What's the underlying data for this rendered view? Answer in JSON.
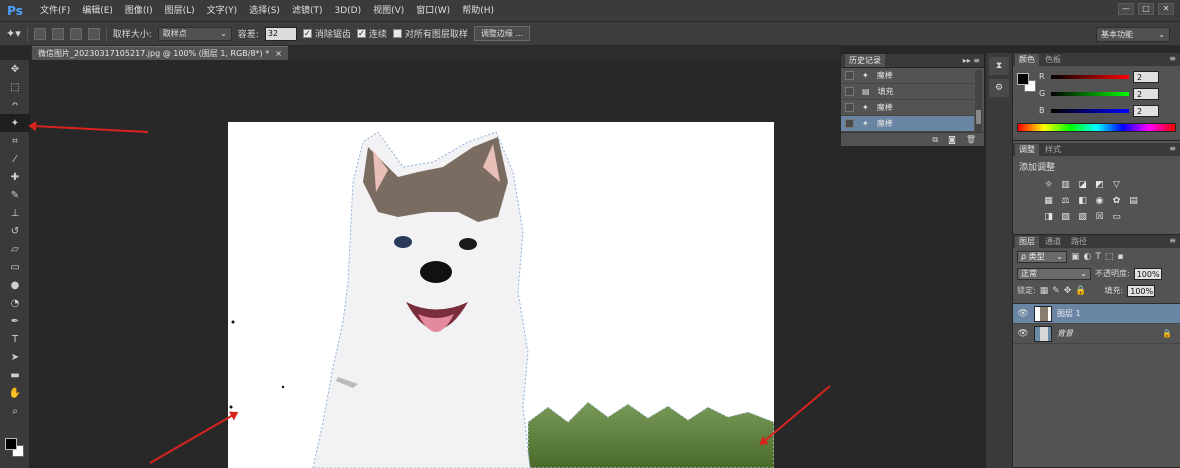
{
  "app": {
    "logo": "Ps"
  },
  "menu": [
    "文件(F)",
    "编辑(E)",
    "图像(I)",
    "图层(L)",
    "文字(Y)",
    "选择(S)",
    "滤镜(T)",
    "3D(D)",
    "视图(V)",
    "窗口(W)",
    "帮助(H)"
  ],
  "window": {
    "minimize": "—",
    "maximize": "□",
    "close": "✕"
  },
  "options": {
    "sample_size_label": "取样大小:",
    "sample_size_value": "取样点",
    "tolerance_label": "容差:",
    "tolerance_value": "32",
    "antialias_label": "消除锯齿",
    "antialias_checked": "✓",
    "contiguous_label": "连续",
    "contiguous_checked": "✓",
    "all_layers_label": "对所有图层取样",
    "refine_button": "调整边缘 ...",
    "workspace": "基本功能"
  },
  "document": {
    "tab_title": "微信图片_20230317105217.jpg @ 100% (图层 1, RGB/8*) *",
    "close": "×"
  },
  "history": {
    "tab": "历史记录",
    "menu": "▸▸ ≡",
    "items": [
      {
        "name": "魔棒"
      },
      {
        "name": "填充"
      },
      {
        "name": "魔棒"
      },
      {
        "name": "魔棒"
      }
    ],
    "selected_index": 3
  },
  "color": {
    "tabs": [
      "颜色",
      "色板"
    ],
    "channels": [
      {
        "label": "R",
        "value": "2"
      },
      {
        "label": "G",
        "value": "2"
      },
      {
        "label": "B",
        "value": "2"
      }
    ]
  },
  "adjustments": {
    "tabs": [
      "调整",
      "样式"
    ],
    "title": "添加调整"
  },
  "layers": {
    "tabs": [
      "图层",
      "通道",
      "路径"
    ],
    "filter": "ρ 类型",
    "blend": "正常",
    "opacity_label": "不透明度:",
    "opacity_value": "100%",
    "lock_label": "锁定:",
    "fill_label": "填充:",
    "fill_value": "100%",
    "items": [
      {
        "name": "图层 1"
      },
      {
        "name": "背景"
      }
    ]
  }
}
